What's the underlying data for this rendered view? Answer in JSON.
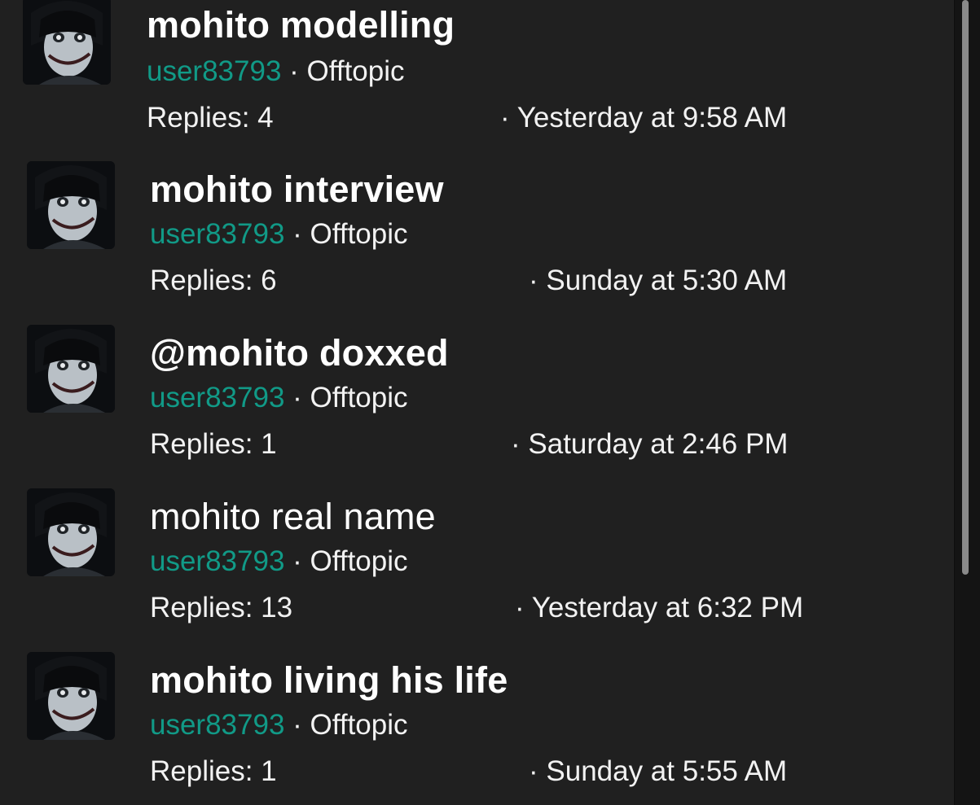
{
  "colors": {
    "background": "#202020",
    "author_link": "#119a87",
    "text": "#ffffff"
  },
  "separator": "·",
  "threads": [
    {
      "title": "mohito modelling",
      "title_weight": "bold",
      "author": "user83793",
      "forum": "Offtopic",
      "replies": "Replies: 4",
      "date": "· Yesterday at 9:58 AM"
    },
    {
      "title": "mohito interview",
      "title_weight": "bold",
      "author": "user83793",
      "forum": "Offtopic",
      "replies": "Replies: 6",
      "date": "· Sunday at 5:30 AM"
    },
    {
      "title": "@mohito doxxed",
      "title_weight": "bold",
      "author": "user83793",
      "forum": "Offtopic",
      "replies": "Replies: 1",
      "date": "· Saturday at 2:46 PM"
    },
    {
      "title": "mohito real name",
      "title_weight": "normal",
      "author": "user83793",
      "forum": "Offtopic",
      "replies": "Replies: 13",
      "date": "· Yesterday at 6:32 PM"
    },
    {
      "title": "mohito living his life",
      "title_weight": "bold",
      "author": "user83793",
      "forum": "Offtopic",
      "replies": "Replies: 1",
      "date": "· Sunday at 5:55 AM"
    }
  ]
}
